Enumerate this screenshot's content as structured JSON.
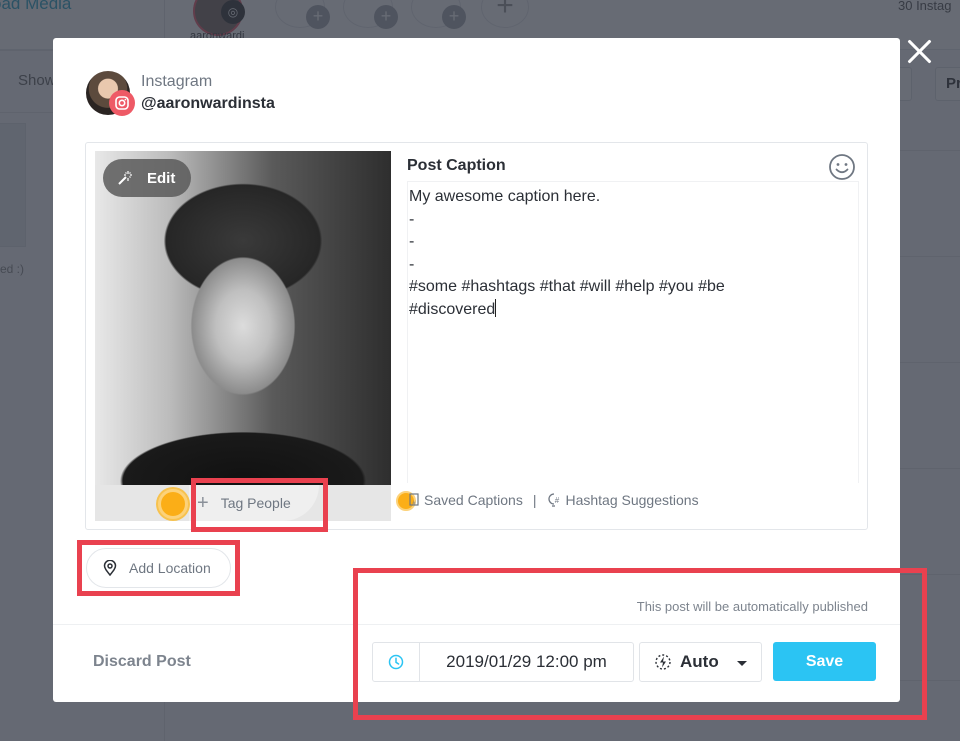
{
  "background": {
    "upload_link": "oad Media",
    "account_name": "aaronwardi",
    "post_count": "30 Instag",
    "show_label": "Show",
    "smile_text": "ed :)",
    "pr_button": "Pr"
  },
  "modal": {
    "account": {
      "network": "Instagram",
      "handle": "@aaronwardinsta"
    },
    "media": {
      "edit_label": "Edit",
      "tag_people_label": "Tag People"
    },
    "caption": {
      "title": "Post Caption",
      "value": "My awesome caption here.\n-\n-\n-\n#some #hashtags #that #will #help #you #be\n#discovered",
      "saved_captions_label": "Saved Captions",
      "separator": "|",
      "hashtag_suggestions_label": "Hashtag Suggestions"
    },
    "add_location_label": "Add Location",
    "publish_note": "This post will be automatically published",
    "discard_label": "Discard Post",
    "schedule": {
      "datetime": "2019/01/29 12:00 pm",
      "mode": "Auto"
    },
    "save_label": "Save"
  },
  "colors": {
    "accent": "#2bc4f3",
    "instagram_badge": "#ee5a66",
    "highlight": "#e9414f",
    "cursor_dot": "#fbae17"
  }
}
